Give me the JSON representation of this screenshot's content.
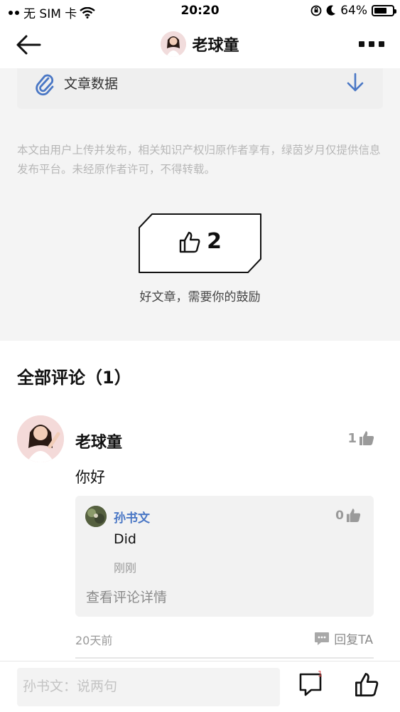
{
  "status_bar": {
    "carrier": "无 SIM 卡",
    "time": "20:20",
    "battery": "64%"
  },
  "nav": {
    "title": "老球童"
  },
  "article": {
    "data_label": "文章数据",
    "disclaimer": "本文由用户上传并发布，相关知识产权归原作者享有，绿茵岁月仅提供信息发布平台。未经原作者许可，不得转载。",
    "like_count": "2",
    "like_caption": "好文章，需要你的鼓励"
  },
  "comments": {
    "title": "全部评论（1）",
    "items": [
      {
        "author": "老球童",
        "likes": "1",
        "text": "你好",
        "time": "20天前",
        "reply_label": "回复TA",
        "replies": [
          {
            "author": "孙书文",
            "likes": "0",
            "text": "Did",
            "time": "刚刚"
          }
        ],
        "view_details": "查看评论详情"
      }
    ]
  },
  "bottom_bar": {
    "input_placeholder": "孙书文：说两句",
    "comment_badge": "1"
  },
  "colors": {
    "accent_blue": "#4a77c5",
    "background": "#f4f4f4",
    "muted_text": "#9a9a9a"
  }
}
